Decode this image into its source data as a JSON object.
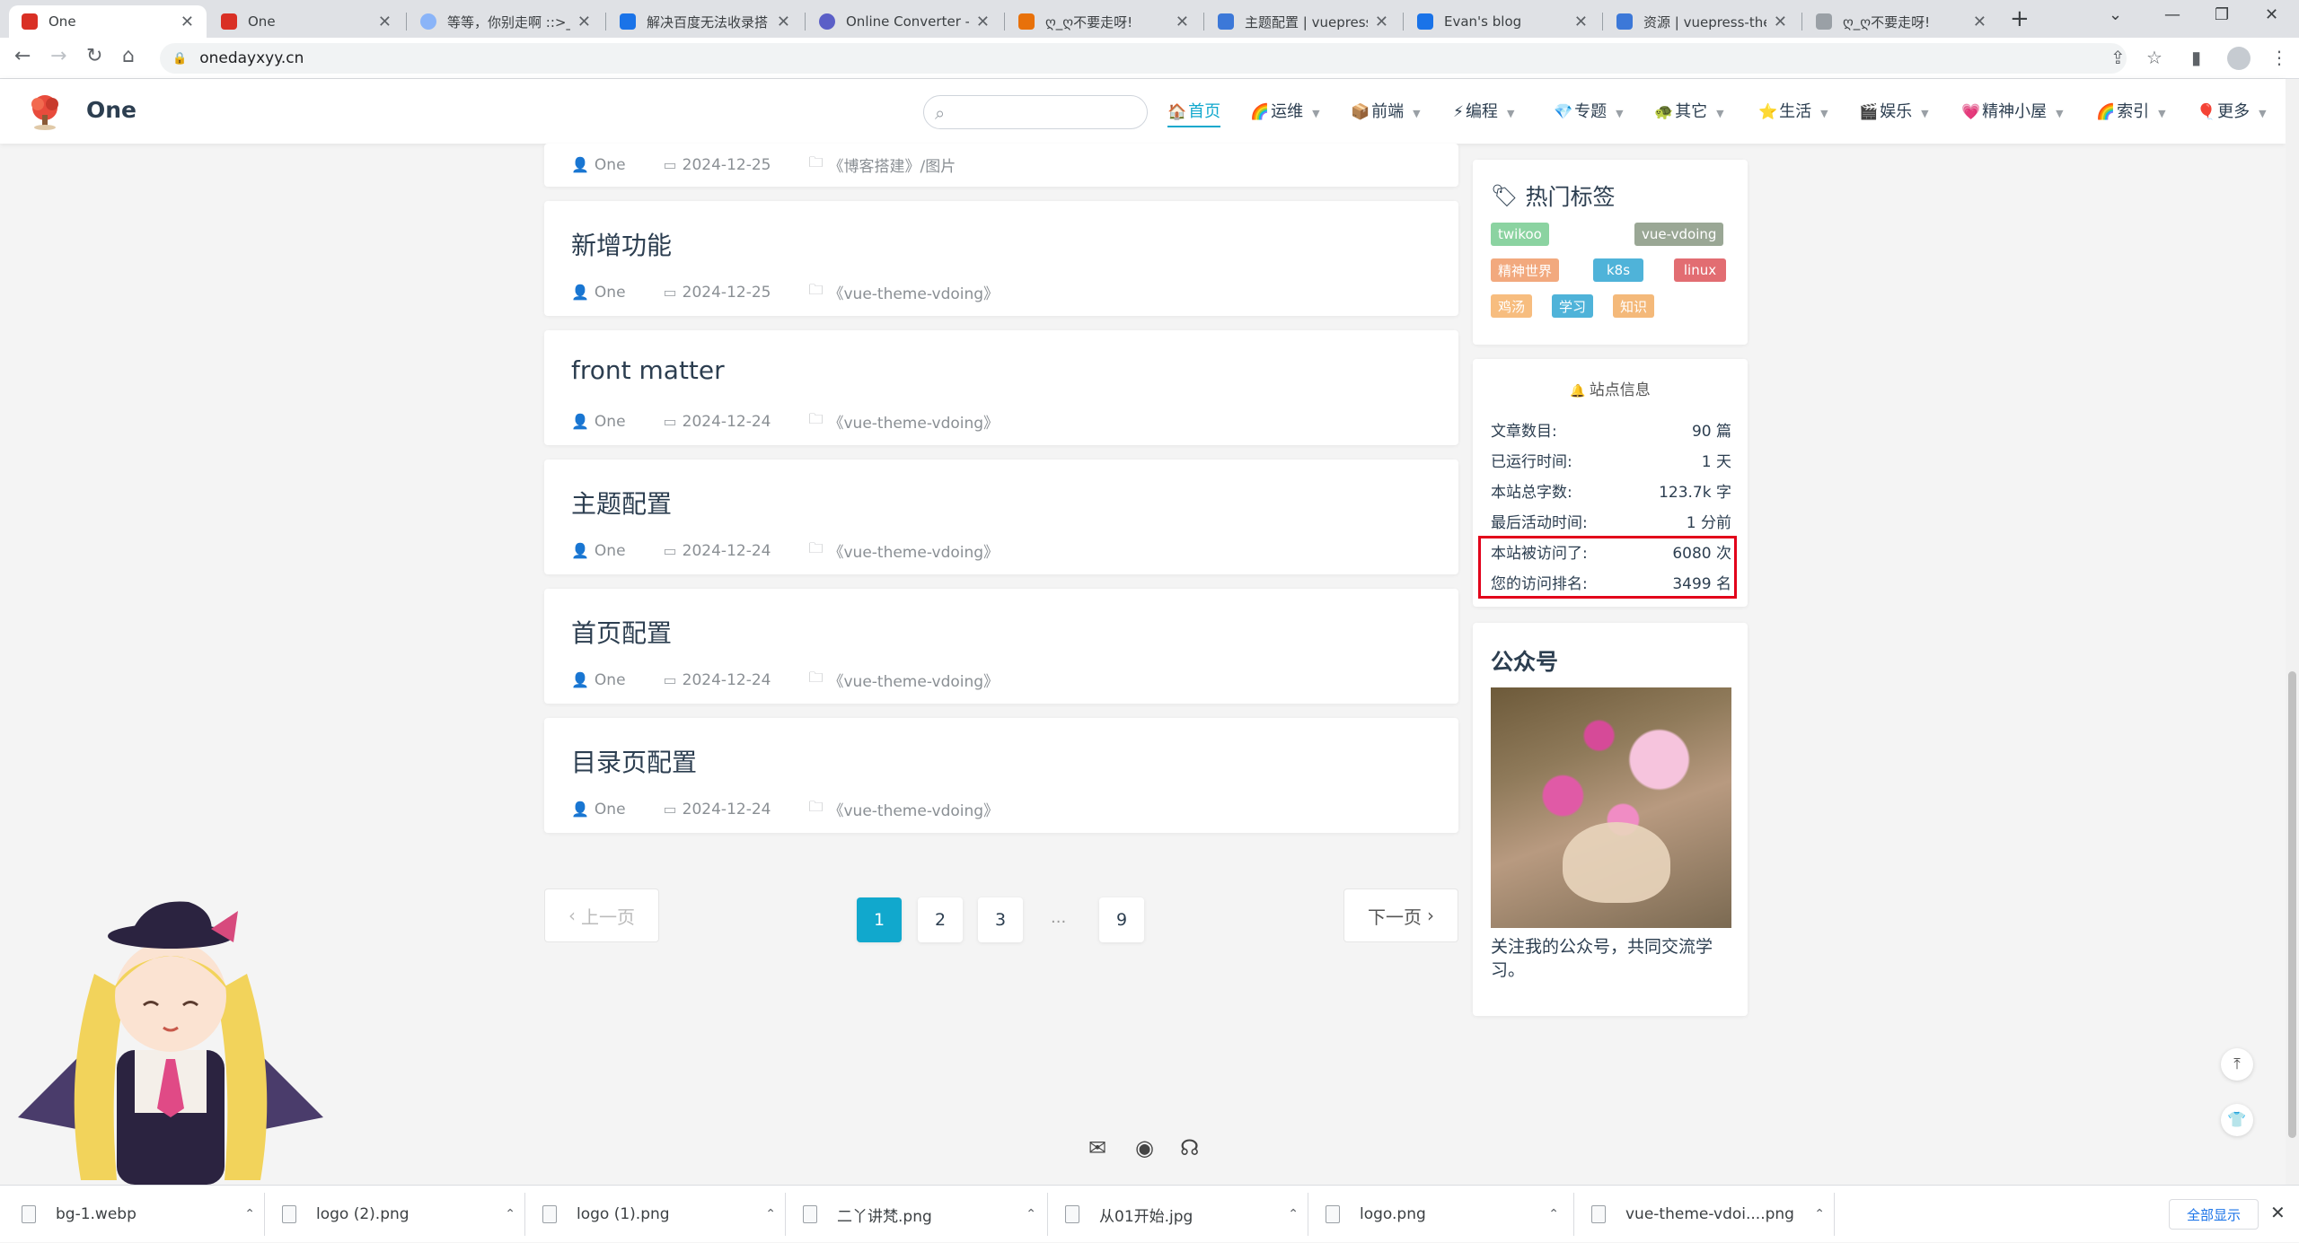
{
  "browser": {
    "tabs": [
      {
        "title": "One",
        "favicon": "tree-logo-icon",
        "color": "#d93025"
      },
      {
        "title": "One",
        "favicon": "tree-logo-icon",
        "color": "#d93025"
      },
      {
        "title": "等等，你别走啊 ::>_",
        "favicon": "avatar-icon",
        "color": "#8ab4f8"
      },
      {
        "title": "解决百度无法收录搭",
        "favicon": "eb-icon",
        "color": "#1a73e8"
      },
      {
        "title": "Online Converter -",
        "favicon": "converter-icon",
        "color": "#5b5fc7"
      },
      {
        "title": "ღ_ღ不要走呀!",
        "favicon": "candle-icon",
        "color": "#e8710a"
      },
      {
        "title": "主题配置 | vuepress",
        "favicon": "vuepress-icon",
        "color": "#3c78d8"
      },
      {
        "title": "Evan's blog",
        "favicon": "eb-icon",
        "color": "#1a73e8"
      },
      {
        "title": "资源 | vuepress-the",
        "favicon": "vuepress-icon",
        "color": "#3c78d8"
      },
      {
        "title": "ღ_ღ不要走呀!",
        "favicon": "page-icon",
        "color": "#9aa0a6"
      }
    ],
    "url": "onedayxyy.cn"
  },
  "site": {
    "title": "One",
    "nav": [
      {
        "label": "首页",
        "icon": "🏠",
        "dropdown": false,
        "active": true
      },
      {
        "label": "运维",
        "icon": "🌈",
        "dropdown": true
      },
      {
        "label": "前端",
        "icon": "📦",
        "dropdown": true
      },
      {
        "label": "编程",
        "icon": "⚡",
        "dropdown": true
      },
      {
        "label": "专题",
        "icon": "💎",
        "dropdown": true
      },
      {
        "label": "其它",
        "icon": "🐢",
        "dropdown": true
      },
      {
        "label": "生活",
        "icon": "⭐",
        "dropdown": true
      },
      {
        "label": "娱乐",
        "icon": "🎬",
        "dropdown": true
      },
      {
        "label": "精神小屋",
        "icon": "💗",
        "dropdown": true
      },
      {
        "label": "索引",
        "icon": "🌈",
        "dropdown": true
      },
      {
        "label": "更多",
        "icon": "🎈",
        "dropdown": true
      }
    ]
  },
  "posts": [
    {
      "title": "",
      "author": "One",
      "date": "2024-12-25",
      "category": "《博客搭建》/图片"
    },
    {
      "title": "新增功能",
      "author": "One",
      "date": "2024-12-25",
      "category": "《vue-theme-vdoing》"
    },
    {
      "title": "front matter",
      "author": "One",
      "date": "2024-12-24",
      "category": "《vue-theme-vdoing》"
    },
    {
      "title": "主题配置",
      "author": "One",
      "date": "2024-12-24",
      "category": "《vue-theme-vdoing》"
    },
    {
      "title": "首页配置",
      "author": "One",
      "date": "2024-12-24",
      "category": "《vue-theme-vdoing》"
    },
    {
      "title": "目录页配置",
      "author": "One",
      "date": "2024-12-24",
      "category": "《vue-theme-vdoing》"
    }
  ],
  "pagination": {
    "prev": "上一页",
    "next": "下一页",
    "pages": [
      "1",
      "2",
      "3",
      "9"
    ],
    "current": "1",
    "ellipsis": "..."
  },
  "sidebar": {
    "tags_title": "热门标签",
    "tags": [
      {
        "label": "twikoo",
        "color": "#8bd3a1"
      },
      {
        "label": "vue-vdoing",
        "color": "#9aa795"
      },
      {
        "label": "精神世界",
        "color": "#f2a97e"
      },
      {
        "label": "k8s",
        "color": "#4fb3d9"
      },
      {
        "label": "linux",
        "color": "#e26d72"
      },
      {
        "label": "鸡汤",
        "color": "#f7bd7f"
      },
      {
        "label": "学习",
        "color": "#4fb3d9"
      },
      {
        "label": "知识",
        "color": "#f4b97a"
      }
    ],
    "site_info_title": "站点信息",
    "site_info": [
      {
        "label": "文章数目:",
        "value": "90 篇"
      },
      {
        "label": "已运行时间:",
        "value": "1 天"
      },
      {
        "label": "本站总字数:",
        "value": "123.7k 字"
      },
      {
        "label": "最后活动时间:",
        "value": "1 分前"
      },
      {
        "label": "本站被访问了:",
        "value": "6080 次"
      },
      {
        "label": "您的访问排名:",
        "value": "3499 名"
      }
    ],
    "wechat_title": "公众号",
    "wechat_caption": "关注我的公众号，共同交流学习。"
  },
  "downloads": [
    "bg-1.webp",
    "logo (2).png",
    "logo (1).png",
    "二丫讲梵.png",
    "从01开始.jpg",
    "logo.png",
    "vue-theme-vdoi....png"
  ],
  "download_show_all": "全部显示"
}
